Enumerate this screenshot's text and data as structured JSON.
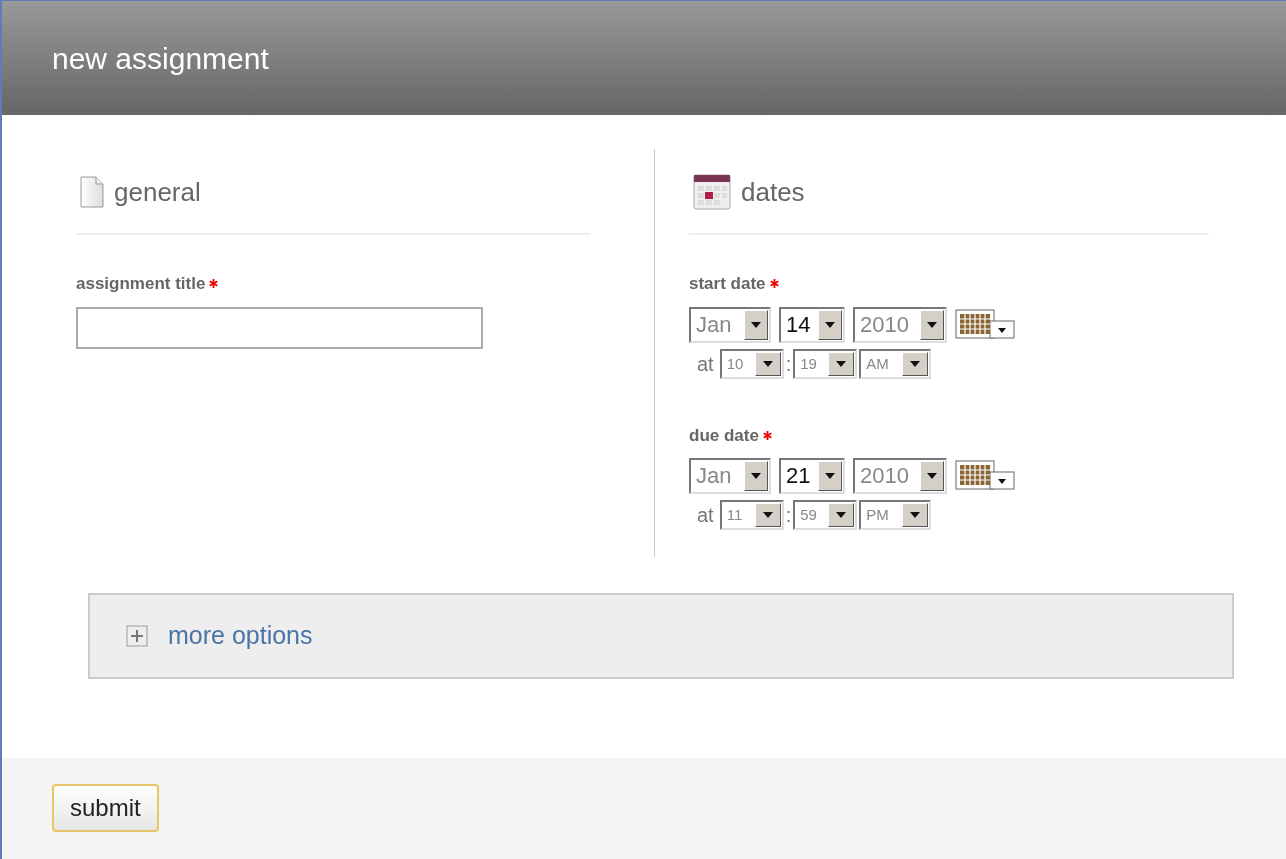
{
  "header": {
    "title": "new assignment"
  },
  "general": {
    "heading": "general",
    "fields": [
      {
        "label": "assignment title",
        "required": true
      }
    ]
  },
  "dates": {
    "heading": "dates",
    "groups": [
      {
        "label": "start date",
        "required": true,
        "month": "Jan",
        "day": "14",
        "year": "2010",
        "at": "at",
        "hour": "10",
        "separator": ":",
        "minute": "19",
        "ampm": "AM"
      },
      {
        "label": "due date",
        "required": true,
        "month": "Jan",
        "day": "21",
        "year": "2010",
        "at": "at",
        "hour": "11",
        "separator": ":",
        "minute": "59",
        "ampm": "PM"
      }
    ]
  },
  "more_options": {
    "label": "more options",
    "expanded": false
  },
  "footer": {
    "button": "submit"
  }
}
